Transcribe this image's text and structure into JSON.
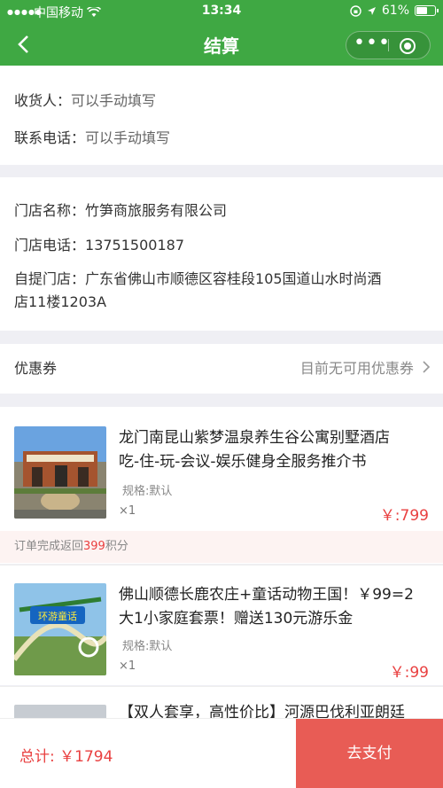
{
  "status_bar": {
    "carrier": "中国移动",
    "time": "13:34",
    "battery": "61%",
    "battery_level": 0.61,
    "icons": [
      "signal-icon",
      "wifi-icon",
      "lock-rotation-icon",
      "location-arrow-icon",
      "battery-icon"
    ]
  },
  "nav": {
    "title": "结算",
    "back_icon": "chevron-left-icon",
    "more_icon": "more-dots-icon",
    "close_icon": "target-icon"
  },
  "receiver": {
    "name_label": "收货人：",
    "name_value": "可以手动填写",
    "phone_label": "联系电话：",
    "phone_value": "可以手动填写"
  },
  "store": {
    "name_label": "门店名称：",
    "name_value": "竹笋商旅服务有限公司",
    "phone_label": "门店电话：",
    "phone_value": "13751500187",
    "pickup_label": "自提门店：",
    "pickup_value_line1": "广东省佛山市顺德区容桂段105国道山水时尚酒",
    "pickup_value_line2": "店11楼1203A"
  },
  "coupon": {
    "label": "优惠券",
    "value": "目前无可用优惠券",
    "chevron": "chevron-right-icon"
  },
  "products": [
    {
      "title_line1": "龙门南昆山紫梦温泉养生谷公寓别墅酒店",
      "title_line2": "吃-住-玩-会议-娱乐健身全服务推介书",
      "spec": "规格:默认",
      "qty": "×1",
      "price": "￥:799",
      "points_prefix": "订单完成返回",
      "points_value": "399",
      "points_suffix": "积分"
    },
    {
      "title_line1": "佛山顺德长鹿农庄+童话动物王国！￥99=2",
      "title_line2": "大1小家庭套票！赠送130元游乐金",
      "spec": "规格:默认",
      "qty": "×1",
      "price": "￥:99"
    },
    {
      "title_line1": "【双人套享，高性价比】河源巴伐利亚朗廷"
    }
  ],
  "footer": {
    "total": "总计: ￥1794",
    "pay_label": "去支付"
  },
  "colors": {
    "brand_green": "#3fa843",
    "price_red": "#e94040",
    "pay_button": "#e85c55"
  }
}
